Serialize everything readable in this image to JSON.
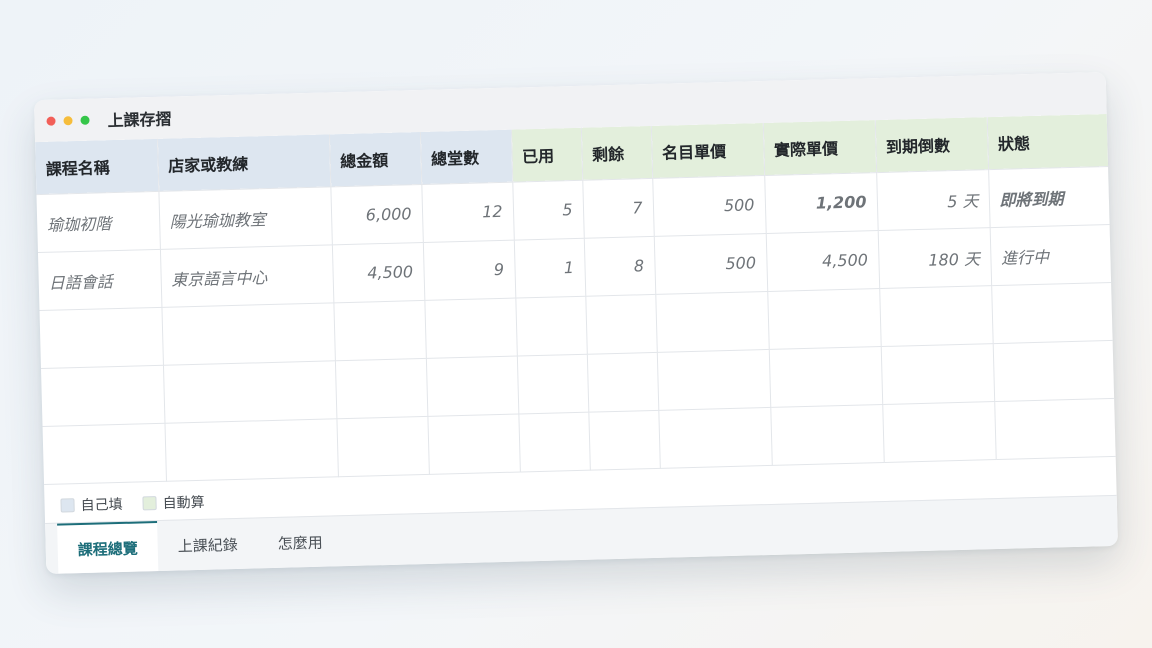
{
  "window": {
    "title": "上課存摺"
  },
  "colors": {
    "input_header": "#dde6f0",
    "auto_header": "#e3efdc",
    "status_warning": "#c9352c",
    "accent": "#1d6e7a"
  },
  "table": {
    "headers": [
      "課程名稱",
      "店家或教練",
      "總金額",
      "總堂數",
      "已用",
      "剩餘",
      "名目單價",
      "實際單價",
      "到期倒數",
      "狀態"
    ],
    "rows": [
      [
        "瑜珈初階",
        "陽光瑜珈教室",
        "6,000",
        "12",
        "5",
        "7",
        "500",
        "1,200",
        "5 天",
        "即將到期"
      ],
      [
        "日語會話",
        "東京語言中心",
        "4,500",
        "9",
        "1",
        "8",
        "500",
        "4,500",
        "180 天",
        "進行中"
      ]
    ]
  },
  "legend": {
    "manual_label": "自己填",
    "auto_label": "自動算"
  },
  "tabs": [
    "課程總覽",
    "上課紀錄",
    "怎麼用"
  ]
}
